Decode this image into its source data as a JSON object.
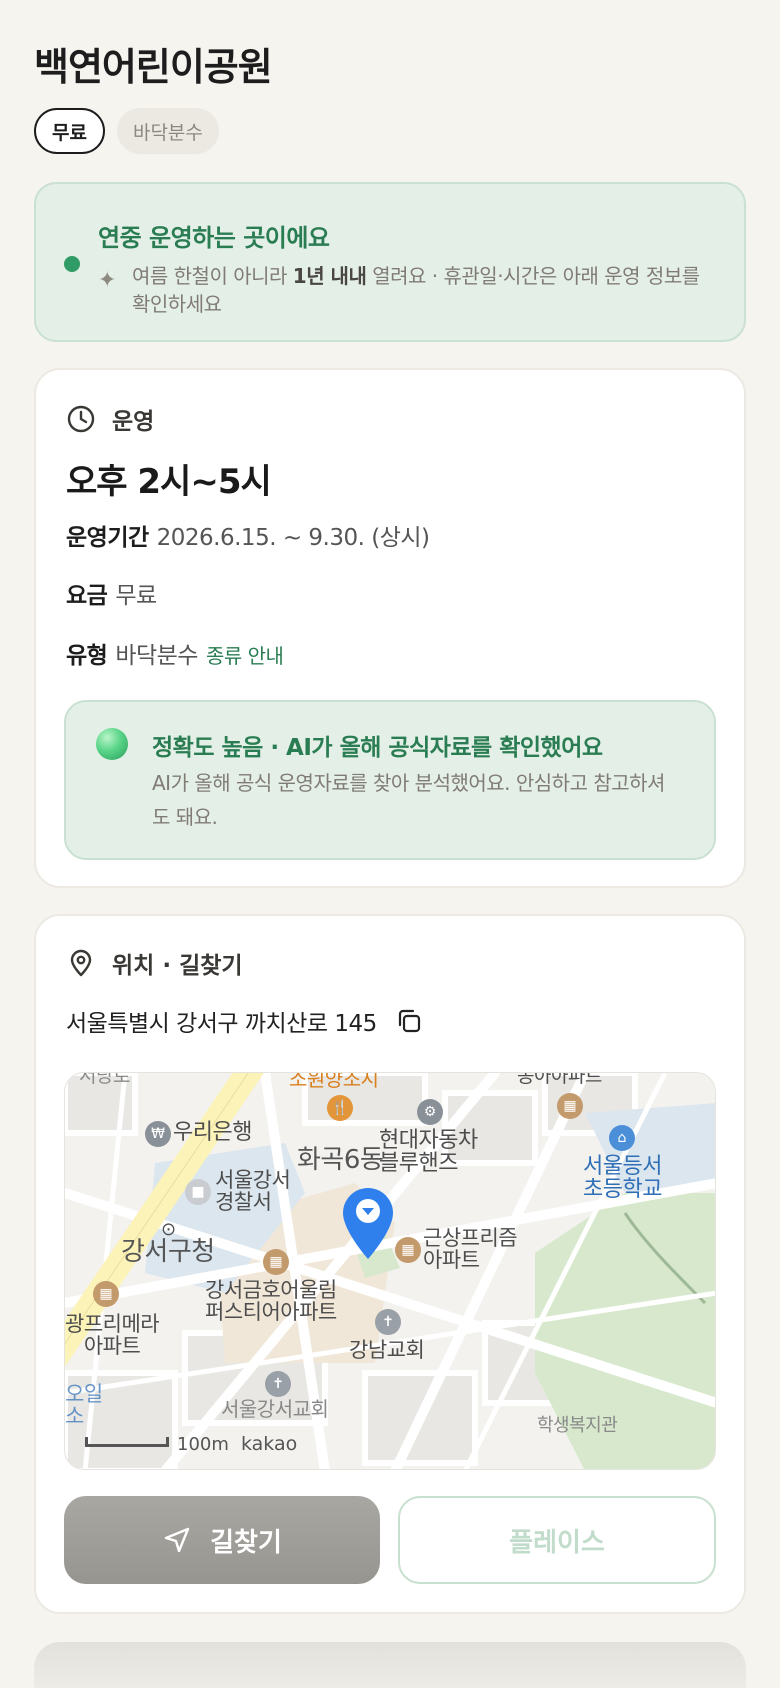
{
  "place": {
    "title": "백연어린이공원",
    "chips": [
      "무료",
      "바닥분수"
    ]
  },
  "notice": {
    "title": "연중 운영하는 곳이에요",
    "desc_pre": "여름 한철이 아니라 ",
    "desc_bold": "1년 내내",
    "desc_post": " 열려요 · 휴관일·시간은 아래 운영 정보를 확인하세요",
    "accent_color": "#2f9b66",
    "icon": "sparkle-icon"
  },
  "operation": {
    "section_label": "운영",
    "icon": "clock-icon",
    "hours": "오후 2시~5시",
    "period_label": "운영기간",
    "period_value": "2026.6.15. ~ 9.30. (상시)",
    "fee_label": "요금",
    "fee_value": "무료",
    "type_label": "유형",
    "type_value": "바닥분수",
    "type_link": "종류 안내"
  },
  "ai": {
    "title": "정확도 높음 · AI가 올해 공식자료를 확인했어요",
    "desc": "AI가 올해 공식 운영자료를 찾아 분석했어요. 안심하고 참고하셔도 돼요."
  },
  "location": {
    "section_label": "위치 · 길찾기",
    "icon": "location-pin-icon",
    "address": "서울특별시 강서구 까치산로 145",
    "copy_icon": "copy-icon"
  },
  "map": {
    "labels": {
      "woori": "우리은행",
      "hwagok": "화곡6동",
      "hyundai": "현대자동차\n블루핸즈",
      "seoul_gangseo_police": "서울강서\n경찰서",
      "gangseo_office": "강서구청",
      "geumho": "강서금호어울림\n퍼스티어아파트",
      "geunsang": "근상프리즘\n아파트",
      "seoul_elem": "서울등서\n초등학교",
      "gwang": "광프리메라\n아파트",
      "gangnam_church": "강남교회",
      "gangseo_church": "서울강서교회",
      "welfare": "학생복지관",
      "top_left": "서당로",
      "top_mid": "소원양조시",
      "top_right": "동아아파트",
      "left_bottom": "오일\n소"
    },
    "scale": "100m",
    "brand": "kakao"
  },
  "buttons": {
    "directions": "길찾기",
    "directions_icon": "navigation-arrow-icon",
    "place": "플레이스"
  }
}
